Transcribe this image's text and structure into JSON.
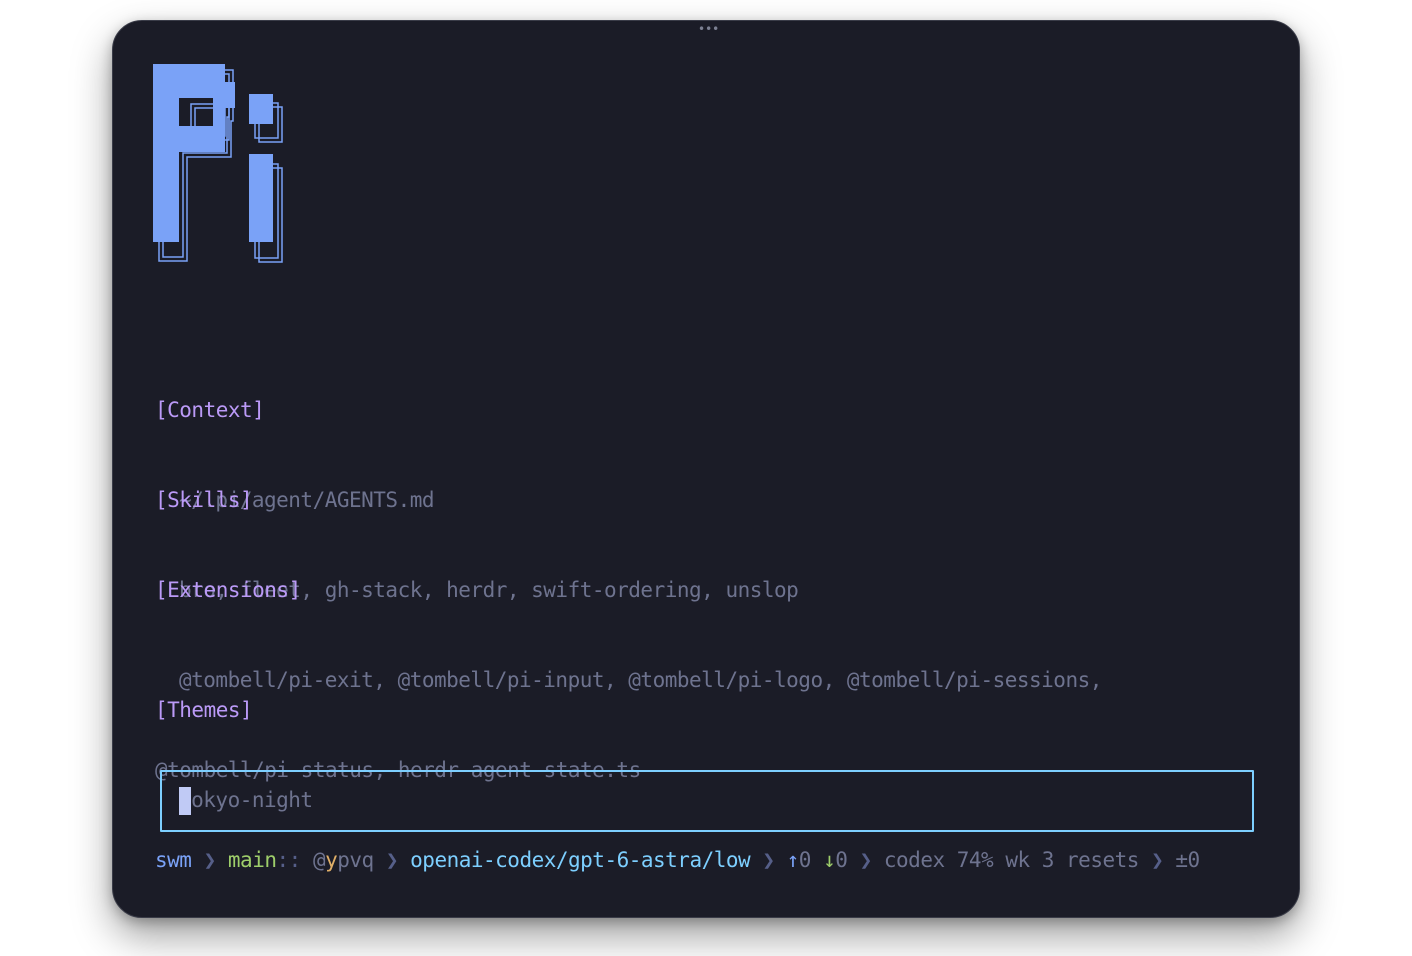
{
  "window": {
    "drag_handle": "•••"
  },
  "logo": {
    "text": "Pi",
    "color": "#7aa2f7"
  },
  "sections": {
    "context": {
      "header": "[Context]",
      "body": "~/.pi/agent/AGENTS.md"
    },
    "skills": {
      "header": "[Skills]",
      "body": "bro, fleet, gh-stack, herdr, swift-ordering, unslop"
    },
    "extensions": {
      "header": "[Extensions]",
      "line1": "@tombell/pi-exit, @tombell/pi-input, @tombell/pi-logo, @tombell/pi-sessions,",
      "line2": "@tombell/pi-status, herdr-agent-state.ts"
    },
    "themes": {
      "header": "[Themes]",
      "body": "tokyo-night"
    }
  },
  "input": {
    "value": ""
  },
  "statusbar": {
    "dir": "swm",
    "sep": "❯",
    "branch": "main",
    "branch_suffix": "::",
    "at": "@",
    "rev_first": "y",
    "rev_rest": "pvq",
    "model": "openai-codex/gpt-6-astra/low",
    "up_arrow": "↑",
    "up_count": "0",
    "down_arrow": "↓",
    "down_count": "0",
    "usage": "codex 74% wk 3 resets",
    "diff": "±0"
  },
  "colors": {
    "background": "#1b1c27",
    "accent_purple": "#bb9af7",
    "accent_blue": "#7aa2f7",
    "accent_cyan": "#7dcfff",
    "accent_green": "#9ece6a",
    "accent_yellow": "#e0af68",
    "muted": "#6e738f"
  }
}
